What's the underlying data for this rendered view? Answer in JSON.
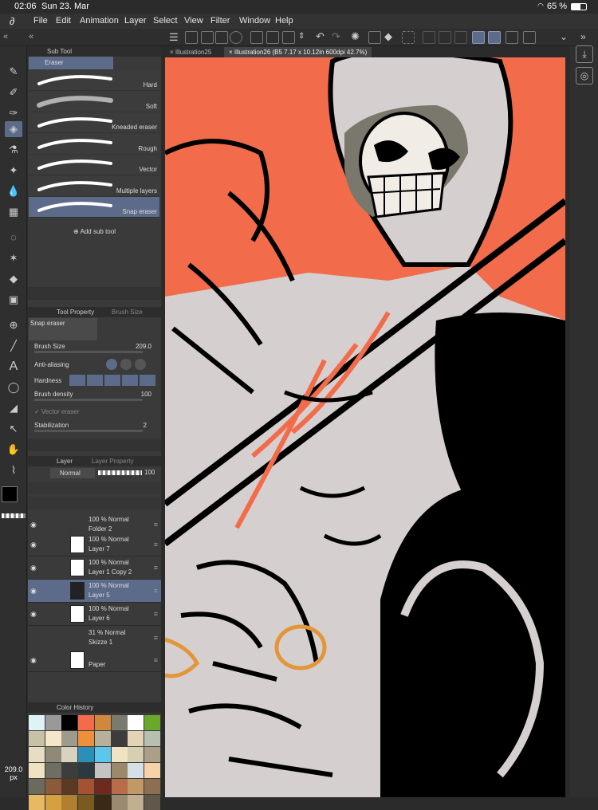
{
  "status": {
    "time": "02:06",
    "date": "Sun 23. Mar",
    "battery": "65 %"
  },
  "menu": [
    "File",
    "Edit",
    "Animation",
    "Layer",
    "Select",
    "View",
    "Filter",
    "Window",
    "Help"
  ],
  "subtool": {
    "header": "Sub Tool",
    "group": "Eraser",
    "items": [
      "Hard",
      "Soft",
      "Kneaded eraser",
      "Rough",
      "Vector",
      "Multiple layers",
      "Snap eraser"
    ],
    "add_label": "Add sub tool"
  },
  "toolprop": {
    "header": "Tool Property",
    "header2": "Brush Size",
    "name": "Snap eraser",
    "brush_size_label": "Brush Size",
    "brush_size_value": "209.0",
    "anti_aliasing_label": "Anti-aliasing",
    "hardness_label": "Hardness",
    "density_label": "Brush density",
    "density_value": "100",
    "vector_eraser_label": "Vector eraser",
    "stabilization_label": "Stabilization",
    "stabilization_value": "2"
  },
  "layer": {
    "header": "Layer",
    "header2": "Layer Property",
    "blend_mode": "Normal",
    "opacity_value": "100",
    "rows": [
      {
        "line1": "100 % Normal",
        "line2": "Folder 2"
      },
      {
        "line1": "100 % Normal",
        "line2": "Layer 7"
      },
      {
        "line1": "100 % Normal",
        "line2": "Layer 1 Copy 2"
      },
      {
        "line1": "100 % Normal",
        "line2": "Layer 5"
      },
      {
        "line1": "100 % Normal",
        "line2": "Layer 6"
      },
      {
        "line1": "31 % Normal",
        "line2": "Skizze 1"
      },
      {
        "line1": "",
        "line2": "Paper"
      }
    ]
  },
  "colorhistory": {
    "header": "Color History",
    "swatches": [
      "#dff3f7",
      "#999999",
      "#000000",
      "#f26b4a",
      "#d0883f",
      "#7a7a6f",
      "#ffffff",
      "#6aa82b",
      "#c9c0a8",
      "#f5e6c8",
      "#9e9a8c",
      "#ee8f3b",
      "#b7b09a",
      "#3c3c3c",
      "#e2d4b5",
      "#b7c0b0",
      "#e8ddc4",
      "#8f8a78",
      "#d9d2c0",
      "#2c8fb8",
      "#5bc7ea",
      "#efe3c2",
      "#d6cfb0",
      "#ab9f88",
      "#f0e2c0",
      "#6f6e63",
      "#3d3d3d",
      "#2c3a40",
      "#c4c4c4",
      "#9b8a6a",
      "#d4e0e6",
      "#f7d1a8",
      "#6b6b5d",
      "#8b5a3a",
      "#5a3a22",
      "#a55232",
      "#6e2a1e",
      "#b86c4a",
      "#c29966",
      "#8e6e50",
      "#e7b964",
      "#d4a040",
      "#b08030",
      "#7a5a20",
      "#3a2a15",
      "#9a8a70",
      "#c0b090",
      "#60584a"
    ]
  },
  "brush_readout": {
    "value": "209.0",
    "unit": "px"
  },
  "tabs": [
    "Illustration25",
    "Illustration26 (B5 7.17 x 10.12in 600dpi 42.7%)"
  ],
  "colors": {
    "accent": "#5d6b8a",
    "canvas_bg": "#d6cfcf",
    "orange": "#f26b4a"
  }
}
